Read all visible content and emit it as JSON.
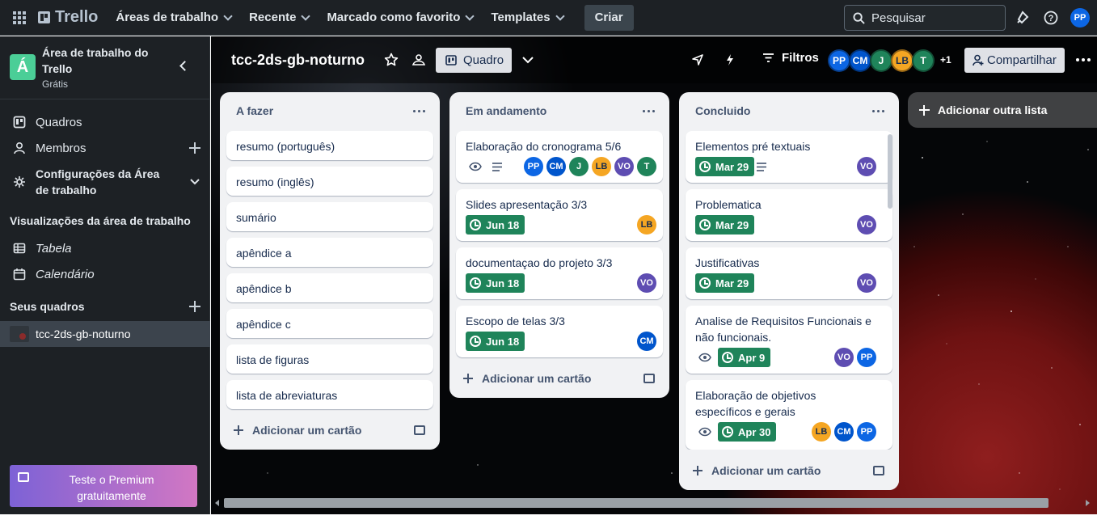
{
  "topbar": {
    "logo": "Trello",
    "nav": [
      "Áreas de trabalho",
      "Recente",
      "Marcado como favorito",
      "Templates"
    ],
    "create": "Criar",
    "search_placeholder": "Pesquisar",
    "user_initials": "PP"
  },
  "sidebar": {
    "workspace_initial": "Á",
    "workspace_name": "Área de trabalho do Trello",
    "workspace_plan": "Grátis",
    "items": {
      "boards": "Quadros",
      "members": "Membros",
      "settings": "Configurações da Área de trabalho"
    },
    "views_title": "Visualizações da área de trabalho",
    "views": {
      "table": "Tabela",
      "calendar": "Calendário"
    },
    "boards_title": "Seus quadros",
    "board_name": "tcc-2ds-gb-noturno",
    "premium": "Teste o Premium gratuitamente"
  },
  "board": {
    "title": "tcc-2ds-gb-noturno",
    "view": "Quadro",
    "filters": "Filtros",
    "members": [
      "PP",
      "CM",
      "J",
      "LB",
      "T"
    ],
    "extra_members": "+1",
    "share": "Compartilhar",
    "add_list": "Adicionar outra lista"
  },
  "lists": {
    "todo": {
      "title": "A fazer",
      "cards": [
        "resumo (português)",
        "resumo (inglês)",
        "sumário",
        "apêndice a",
        "apêndice b",
        "apêndice c",
        "lista de figuras",
        "lista de abreviaturas"
      ],
      "add": "Adicionar um cartão"
    },
    "doing": {
      "title": "Em andamento",
      "cards": {
        "c1": {
          "title": "Elaboração do cronograma 5/6",
          "members": [
            "PP",
            "CM",
            "J",
            "LB",
            "VO",
            "T"
          ]
        },
        "c2": {
          "title": "Slides apresentação 3/3",
          "date": "Jun 18",
          "members": [
            "LB"
          ]
        },
        "c3": {
          "title": "documentaçao do projeto 3/3",
          "date": "Jun 18",
          "members": [
            "VO"
          ]
        },
        "c4": {
          "title": "Escopo de telas 3/3",
          "date": "Jun 18",
          "members": [
            "CM"
          ]
        }
      },
      "add": "Adicionar um cartão"
    },
    "done": {
      "title": "Concluido",
      "cards": {
        "c1": {
          "title": "Elementos pré textuais",
          "date": "Mar 29",
          "members": [
            "VO"
          ]
        },
        "c2": {
          "title": "Problematica",
          "date": "Mar 29",
          "members": [
            "VO"
          ]
        },
        "c3": {
          "title": "Justificativas",
          "date": "Mar 29",
          "members": [
            "VO"
          ]
        },
        "c4": {
          "title": "Analise de Requisitos Funcionais e não funcionais.",
          "date": "Apr 9",
          "members": [
            "VO",
            "PP"
          ]
        },
        "c5": {
          "title": "Elaboração de objetivos específicos e gerais",
          "date": "Apr 30",
          "members": [
            "LB",
            "CM",
            "PP"
          ]
        }
      },
      "add": "Adicionar um cartão"
    }
  },
  "colors": {
    "PP": "#0c66e4",
    "CM": "#0055cc",
    "J": "#1f845a",
    "LB": "#f5a623",
    "VO": "#5e4db2",
    "T": "#1f845a",
    "due_complete": "#1f845a",
    "workspace": "#4bce97"
  }
}
